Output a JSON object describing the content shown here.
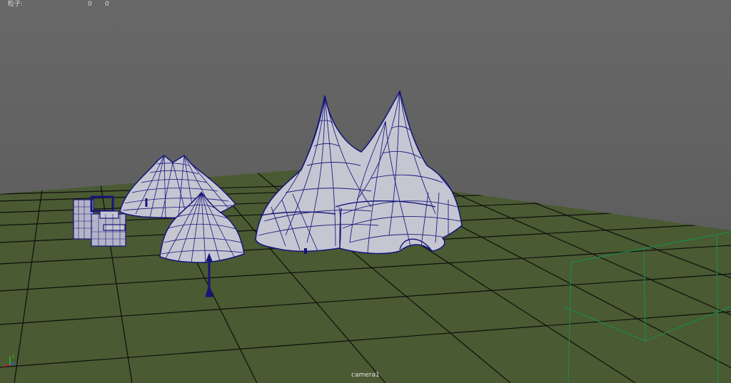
{
  "viewport": {
    "hud": {
      "particles_label": "粒子:",
      "value_1": "0",
      "value_2": "0"
    },
    "camera_label": "camera1",
    "axis": {
      "x_label": "x",
      "y_label": "y",
      "x_color": "#d01818",
      "y_color": "#28c028",
      "z_color": "#2a58ff"
    },
    "colors": {
      "background": "#5f5f5f",
      "ground": "#4a5a32",
      "grid_line": "#0e0e0e",
      "wire": "#16167a",
      "surface": "#c6c6d2",
      "frustum": "#1c8a4c"
    }
  }
}
